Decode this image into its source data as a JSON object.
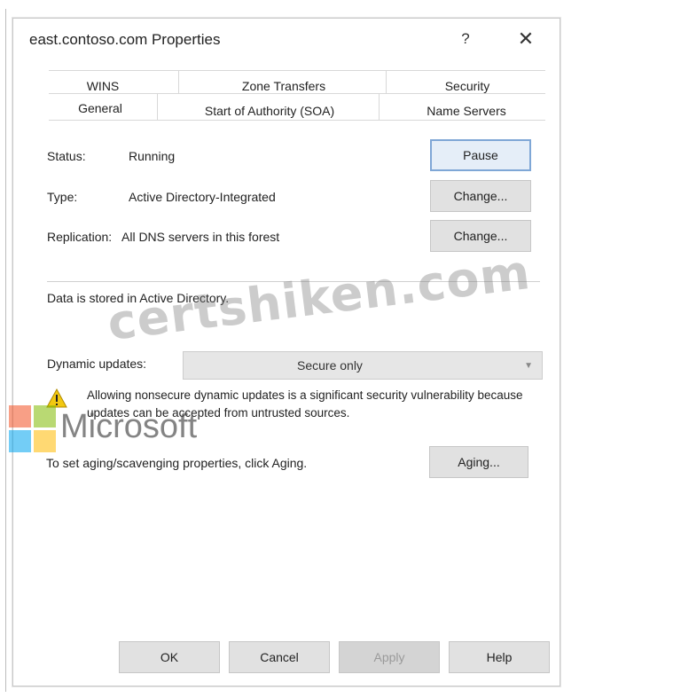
{
  "window": {
    "title": "east.contoso.com Properties",
    "help_glyph": "?",
    "close_glyph": "✕"
  },
  "tabs": {
    "row1": [
      "WINS",
      "Zone Transfers",
      "Security"
    ],
    "row2": [
      "General",
      "Start of Authority (SOA)",
      "Name Servers"
    ],
    "active": "General"
  },
  "general": {
    "status_label": "Status:",
    "status_value": "Running",
    "pause_button": "Pause",
    "type_label": "Type:",
    "type_value": "Active Directory-Integrated",
    "type_change_button": "Change...",
    "replication_label": "Replication:",
    "replication_value": "All DNS servers in this forest",
    "replication_change_button": "Change...",
    "stored_text": "Data is stored in Active Directory.",
    "dynamic_updates_label": "Dynamic updates:",
    "dynamic_updates_value": "Secure only",
    "warning_text": "Allowing nonsecure dynamic updates is a significant security vulnerability because updates can be accepted from untrusted sources.",
    "aging_text": "To set aging/scavenging properties, click Aging.",
    "aging_button": "Aging..."
  },
  "footer": {
    "ok": "OK",
    "cancel": "Cancel",
    "apply": "Apply",
    "help": "Help"
  },
  "watermark": {
    "site": "certshiken.com",
    "brand": "Microsoft"
  },
  "icons": {
    "warning": "warning-icon",
    "close": "close-icon",
    "help": "help-icon"
  },
  "colors": {
    "default_button_border": "#7fa7d6",
    "warning_yellow": "#f2c811"
  }
}
